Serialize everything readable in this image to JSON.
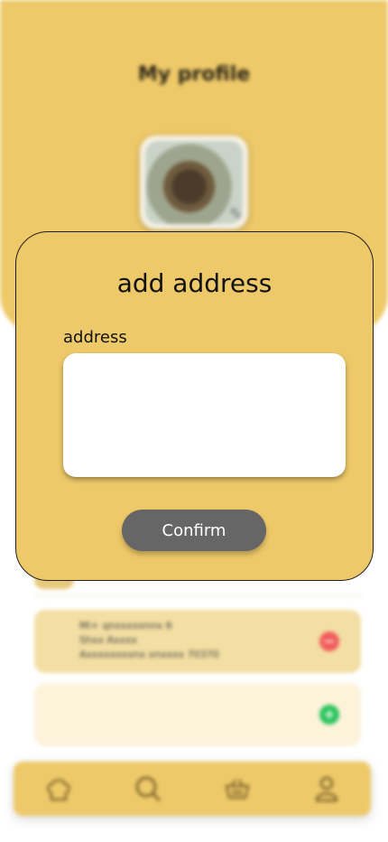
{
  "profile": {
    "title": "My profile"
  },
  "addresses": [
    {
      "lines": [
        "Mi+ qnxxxxxnnx 6",
        "Shxx Axxxx",
        "Axxxxxxxxnx xnxxxx 70370"
      ],
      "action_icon": "remove-icon"
    },
    {
      "lines": [],
      "action_icon": "add-icon"
    }
  ],
  "modal": {
    "title": "add address",
    "field_label": "address",
    "field_value": "",
    "confirm_label": "Confirm"
  },
  "bottom_nav": [
    {
      "name": "nav-home",
      "icon": "chef-hat-icon"
    },
    {
      "name": "nav-search",
      "icon": "search-icon"
    },
    {
      "name": "nav-basket",
      "icon": "basket-icon"
    },
    {
      "name": "nav-profile",
      "icon": "user-icon"
    }
  ],
  "colors": {
    "accent": "#EEC969",
    "confirm_button": "#666666",
    "remove": "#F25A5A",
    "add": "#26C35A"
  }
}
